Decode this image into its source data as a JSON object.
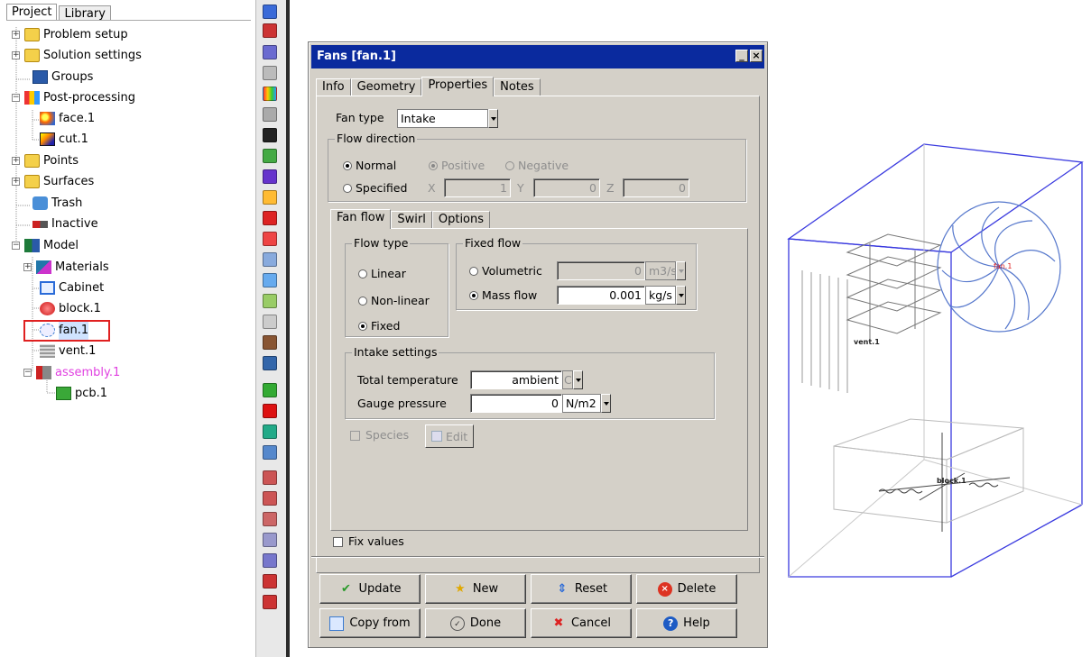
{
  "tree": {
    "tabs": [
      "Project",
      "Library"
    ],
    "items": [
      {
        "label": "Problem setup"
      },
      {
        "label": "Solution settings"
      },
      {
        "label": "Groups"
      },
      {
        "label": "Post-processing"
      },
      {
        "label": "face.1"
      },
      {
        "label": "cut.1"
      },
      {
        "label": "Points"
      },
      {
        "label": "Surfaces"
      },
      {
        "label": "Trash"
      },
      {
        "label": "Inactive"
      },
      {
        "label": "Model"
      },
      {
        "label": "Materials"
      },
      {
        "label": "Cabinet"
      },
      {
        "label": "block.1"
      },
      {
        "label": "fan.1"
      },
      {
        "label": "vent.1"
      },
      {
        "label": "assembly.1"
      },
      {
        "label": "pcb.1"
      }
    ],
    "colors": {
      "assembly": "#e040e0",
      "highlight": "#e02020"
    }
  },
  "dialog": {
    "title": "Fans [fan.1]",
    "tabs": [
      "Info",
      "Geometry",
      "Properties",
      "Notes"
    ],
    "active_tab": "Properties",
    "fan_type_label": "Fan type",
    "fan_type_value": "Intake",
    "flow_direction": {
      "title": "Flow direction",
      "normal": "Normal",
      "positive": "Positive",
      "negative": "Negative",
      "specified": "Specified",
      "x_label": "X",
      "x_value": "1",
      "y_label": "Y",
      "y_value": "0",
      "z_label": "Z",
      "z_value": "0"
    },
    "sub_tabs": [
      "Fan flow",
      "Swirl",
      "Options"
    ],
    "flow_type": {
      "title": "Flow type",
      "options": [
        "Linear",
        "Non-linear",
        "Fixed"
      ],
      "selected": "Fixed"
    },
    "fixed_flow": {
      "title": "Fixed flow",
      "volumetric_label": "Volumetric",
      "volumetric_value": "0",
      "volumetric_unit": "m3/s",
      "mass_label": "Mass flow",
      "mass_value": "0.001",
      "mass_unit": "kg/s"
    },
    "intake": {
      "title": "Intake settings",
      "temp_label": "Total temperature",
      "temp_value": "ambient",
      "temp_unit": "C",
      "pressure_label": "Gauge pressure",
      "pressure_value": "0",
      "pressure_unit": "N/m2"
    },
    "species_label": "Species",
    "edit_label": "Edit",
    "fix_values_label": "Fix values",
    "buttons": {
      "update": "Update",
      "new": "New",
      "reset": "Reset",
      "delete": "Delete",
      "copy_from": "Copy from",
      "done": "Done",
      "cancel": "Cancel",
      "help": "Help"
    }
  },
  "view3d": {
    "labels": {
      "fan": "fan.1",
      "vent": "vent.1",
      "block": "block.1"
    }
  },
  "colors": {
    "titlebar": "#0a2a9e",
    "cabinet_edges": "#3a3adf",
    "dialog_bg": "#d4d0c8"
  }
}
